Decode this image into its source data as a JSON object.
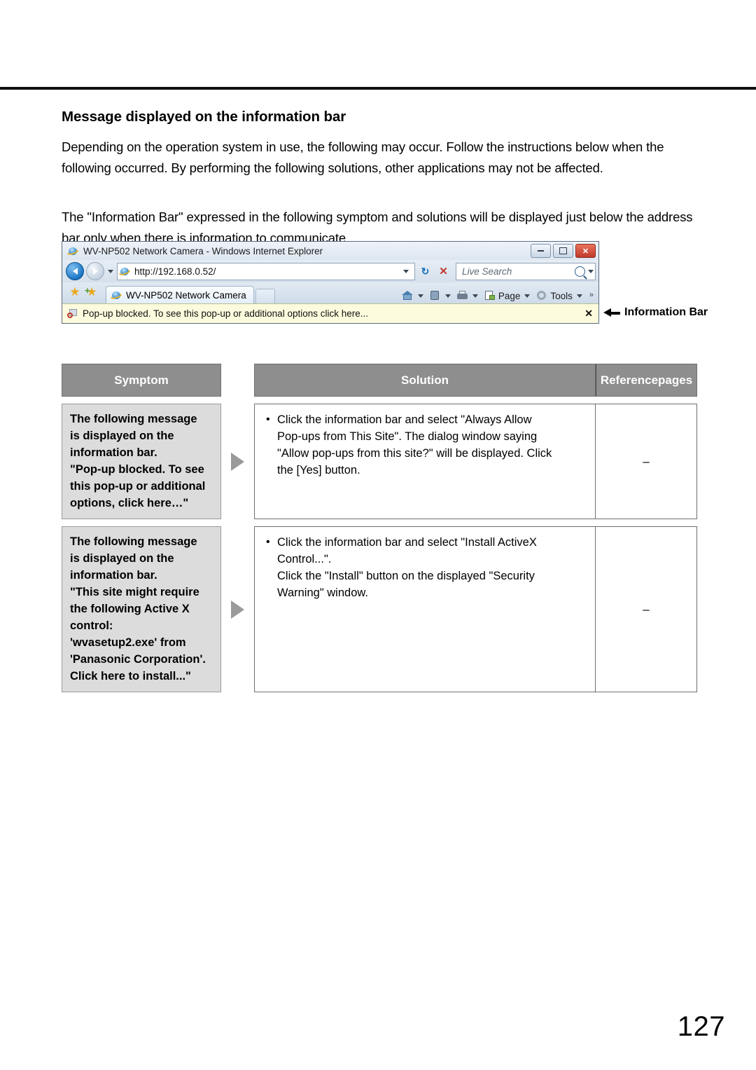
{
  "page": {
    "number": "127"
  },
  "section": {
    "title": "Message displayed on the information bar",
    "paragraph1": "Depending on the operation system in use, the following may occur. Follow the instructions below when the following occurred. By performing the following solutions, other applications may not be affected.",
    "paragraph2": "The \"Information Bar\" expressed in the following symptom and solutions will be displayed just below the address bar only when there is information to communicate."
  },
  "browser": {
    "title": "WV-NP502 Network Camera - Windows Internet Explorer",
    "window_controls": {
      "minimize": "Minimize",
      "maximize": "Maximize",
      "close": "✕"
    },
    "address": {
      "url": "http://192.168.0.52/",
      "history_dropdown": "▾",
      "refresh": "↻",
      "stop": "✕"
    },
    "search": {
      "placeholder": "Live Search",
      "dropdown": "▾"
    },
    "tab": {
      "label": "WV-NP502 Network Camera"
    },
    "toolbar": {
      "page_label": "Page",
      "tools_label": "Tools",
      "more": "»"
    },
    "infobar": {
      "text": "Pop-up blocked. To see this pop-up or additional options click here...",
      "close": "✕"
    }
  },
  "annotation": {
    "label": "Information Bar"
  },
  "table": {
    "headers": {
      "symptom": "Symptom",
      "solution": "Solution",
      "reference_line1": "Reference",
      "reference_line2": "pages"
    },
    "rows": [
      {
        "symptom_lines": [
          "The following message",
          "is displayed on the",
          "information bar.",
          "\"Pop-up blocked. To see",
          "this pop-up or additional",
          "options, click here…\""
        ],
        "solution_lines": [
          "Click the information bar and select \"Always Allow",
          "Pop-ups from This Site\". The dialog window saying",
          "\"Allow pop-ups from this site?\" will be displayed. Click",
          "the [Yes] button."
        ],
        "reference": "–"
      },
      {
        "symptom_lines": [
          "The following message",
          "is displayed on the",
          "information bar.",
          "\"This site might require",
          "the following Active X",
          "control:",
          "'wvasetup2.exe' from",
          "'Panasonic Corporation'.",
          "Click here to install...\""
        ],
        "solution_lines": [
          "Click the information bar and select \"Install ActiveX",
          "Control...\".",
          "Click the \"Install\" button on the displayed \"Security",
          "Warning\" window."
        ],
        "reference": "–"
      }
    ]
  }
}
